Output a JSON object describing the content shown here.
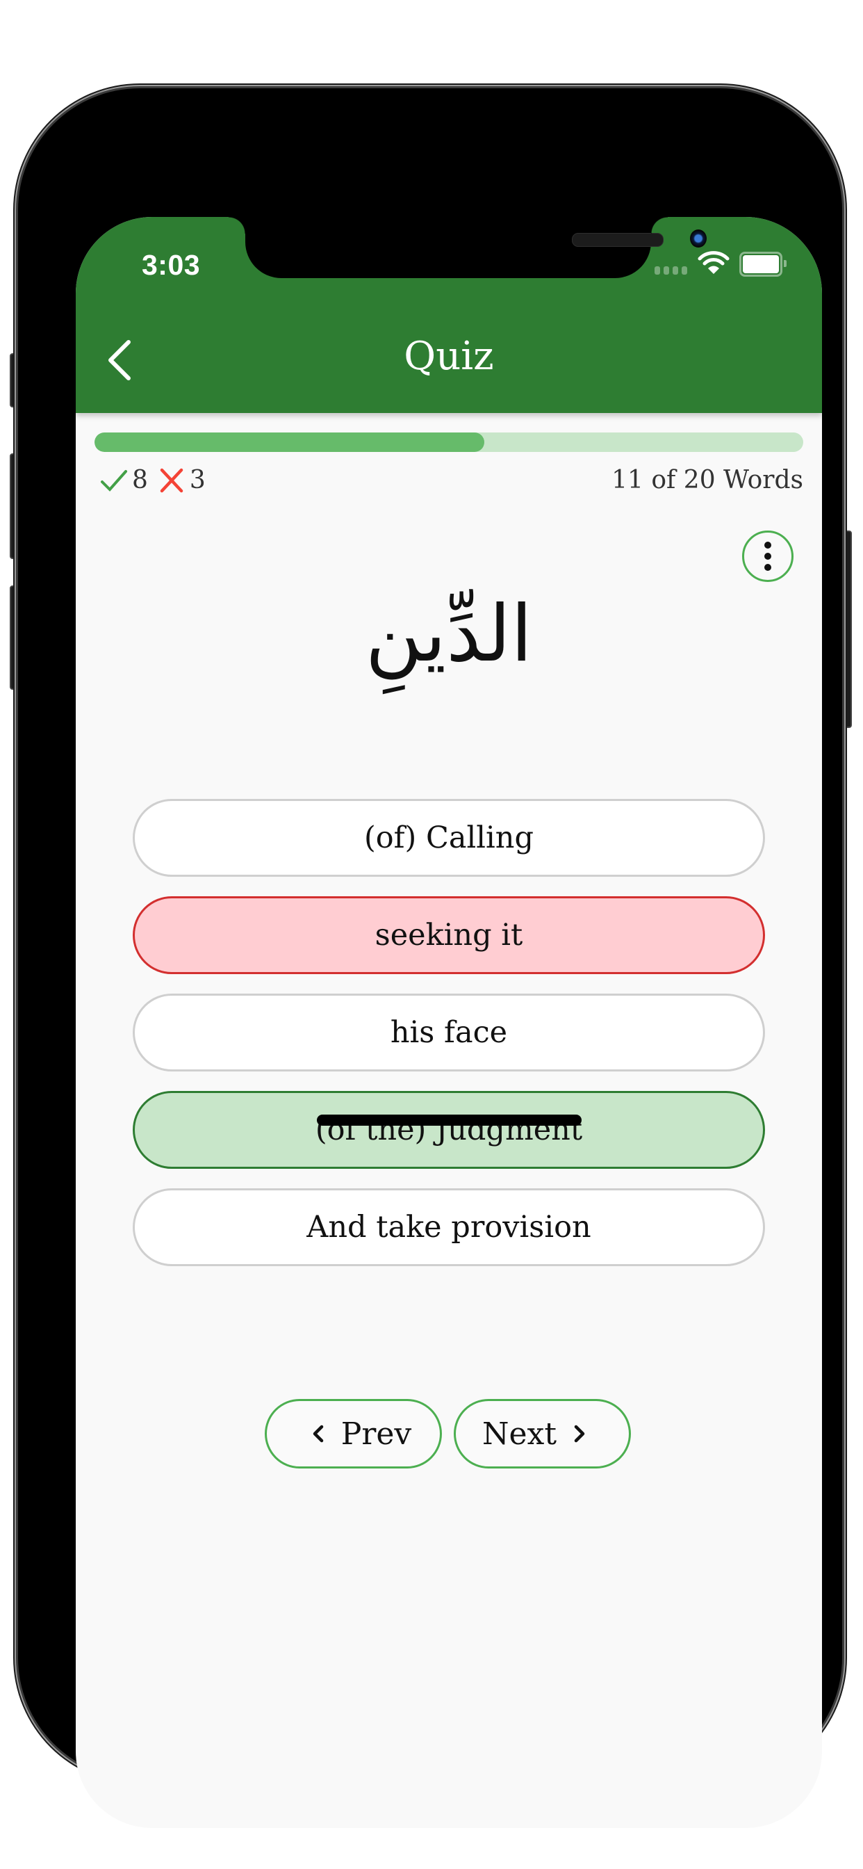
{
  "status_bar": {
    "time": "3:03",
    "icons": [
      "signal-icon",
      "wifi-icon",
      "battery-icon"
    ]
  },
  "header": {
    "title": "Quiz",
    "back_icon": "chevron-left-icon"
  },
  "progress": {
    "current": 11,
    "total": 20,
    "fraction": 0.55,
    "label": "11 of 20 Words",
    "correct_count": "8",
    "wrong_count": "3",
    "correct_icon": "checkmark-icon",
    "wrong_icon": "cross-icon",
    "colors": {
      "fill": "#66BB6A",
      "track": "#C8E6C9"
    }
  },
  "menu": {
    "icon": "more-vertical-icon"
  },
  "question": {
    "word": "الدِّينِ"
  },
  "options": [
    {
      "label": "(of) Calling",
      "state": "default"
    },
    {
      "label": "seeking it",
      "state": "wrong"
    },
    {
      "label": "his face",
      "state": "default"
    },
    {
      "label": "(of the) Judgment",
      "state": "correct"
    },
    {
      "label": "And take provision",
      "state": "default"
    }
  ],
  "navigation": {
    "prev_label": "Prev",
    "next_label": "Next"
  },
  "colors": {
    "primary": "#2E7D32",
    "accent": "#4CAF50",
    "correct_bg": "#C8E6C9",
    "wrong_bg": "#FFCDD2",
    "wrong_border": "#D32F2F",
    "check": "#43A047",
    "cross": "#F44336"
  }
}
